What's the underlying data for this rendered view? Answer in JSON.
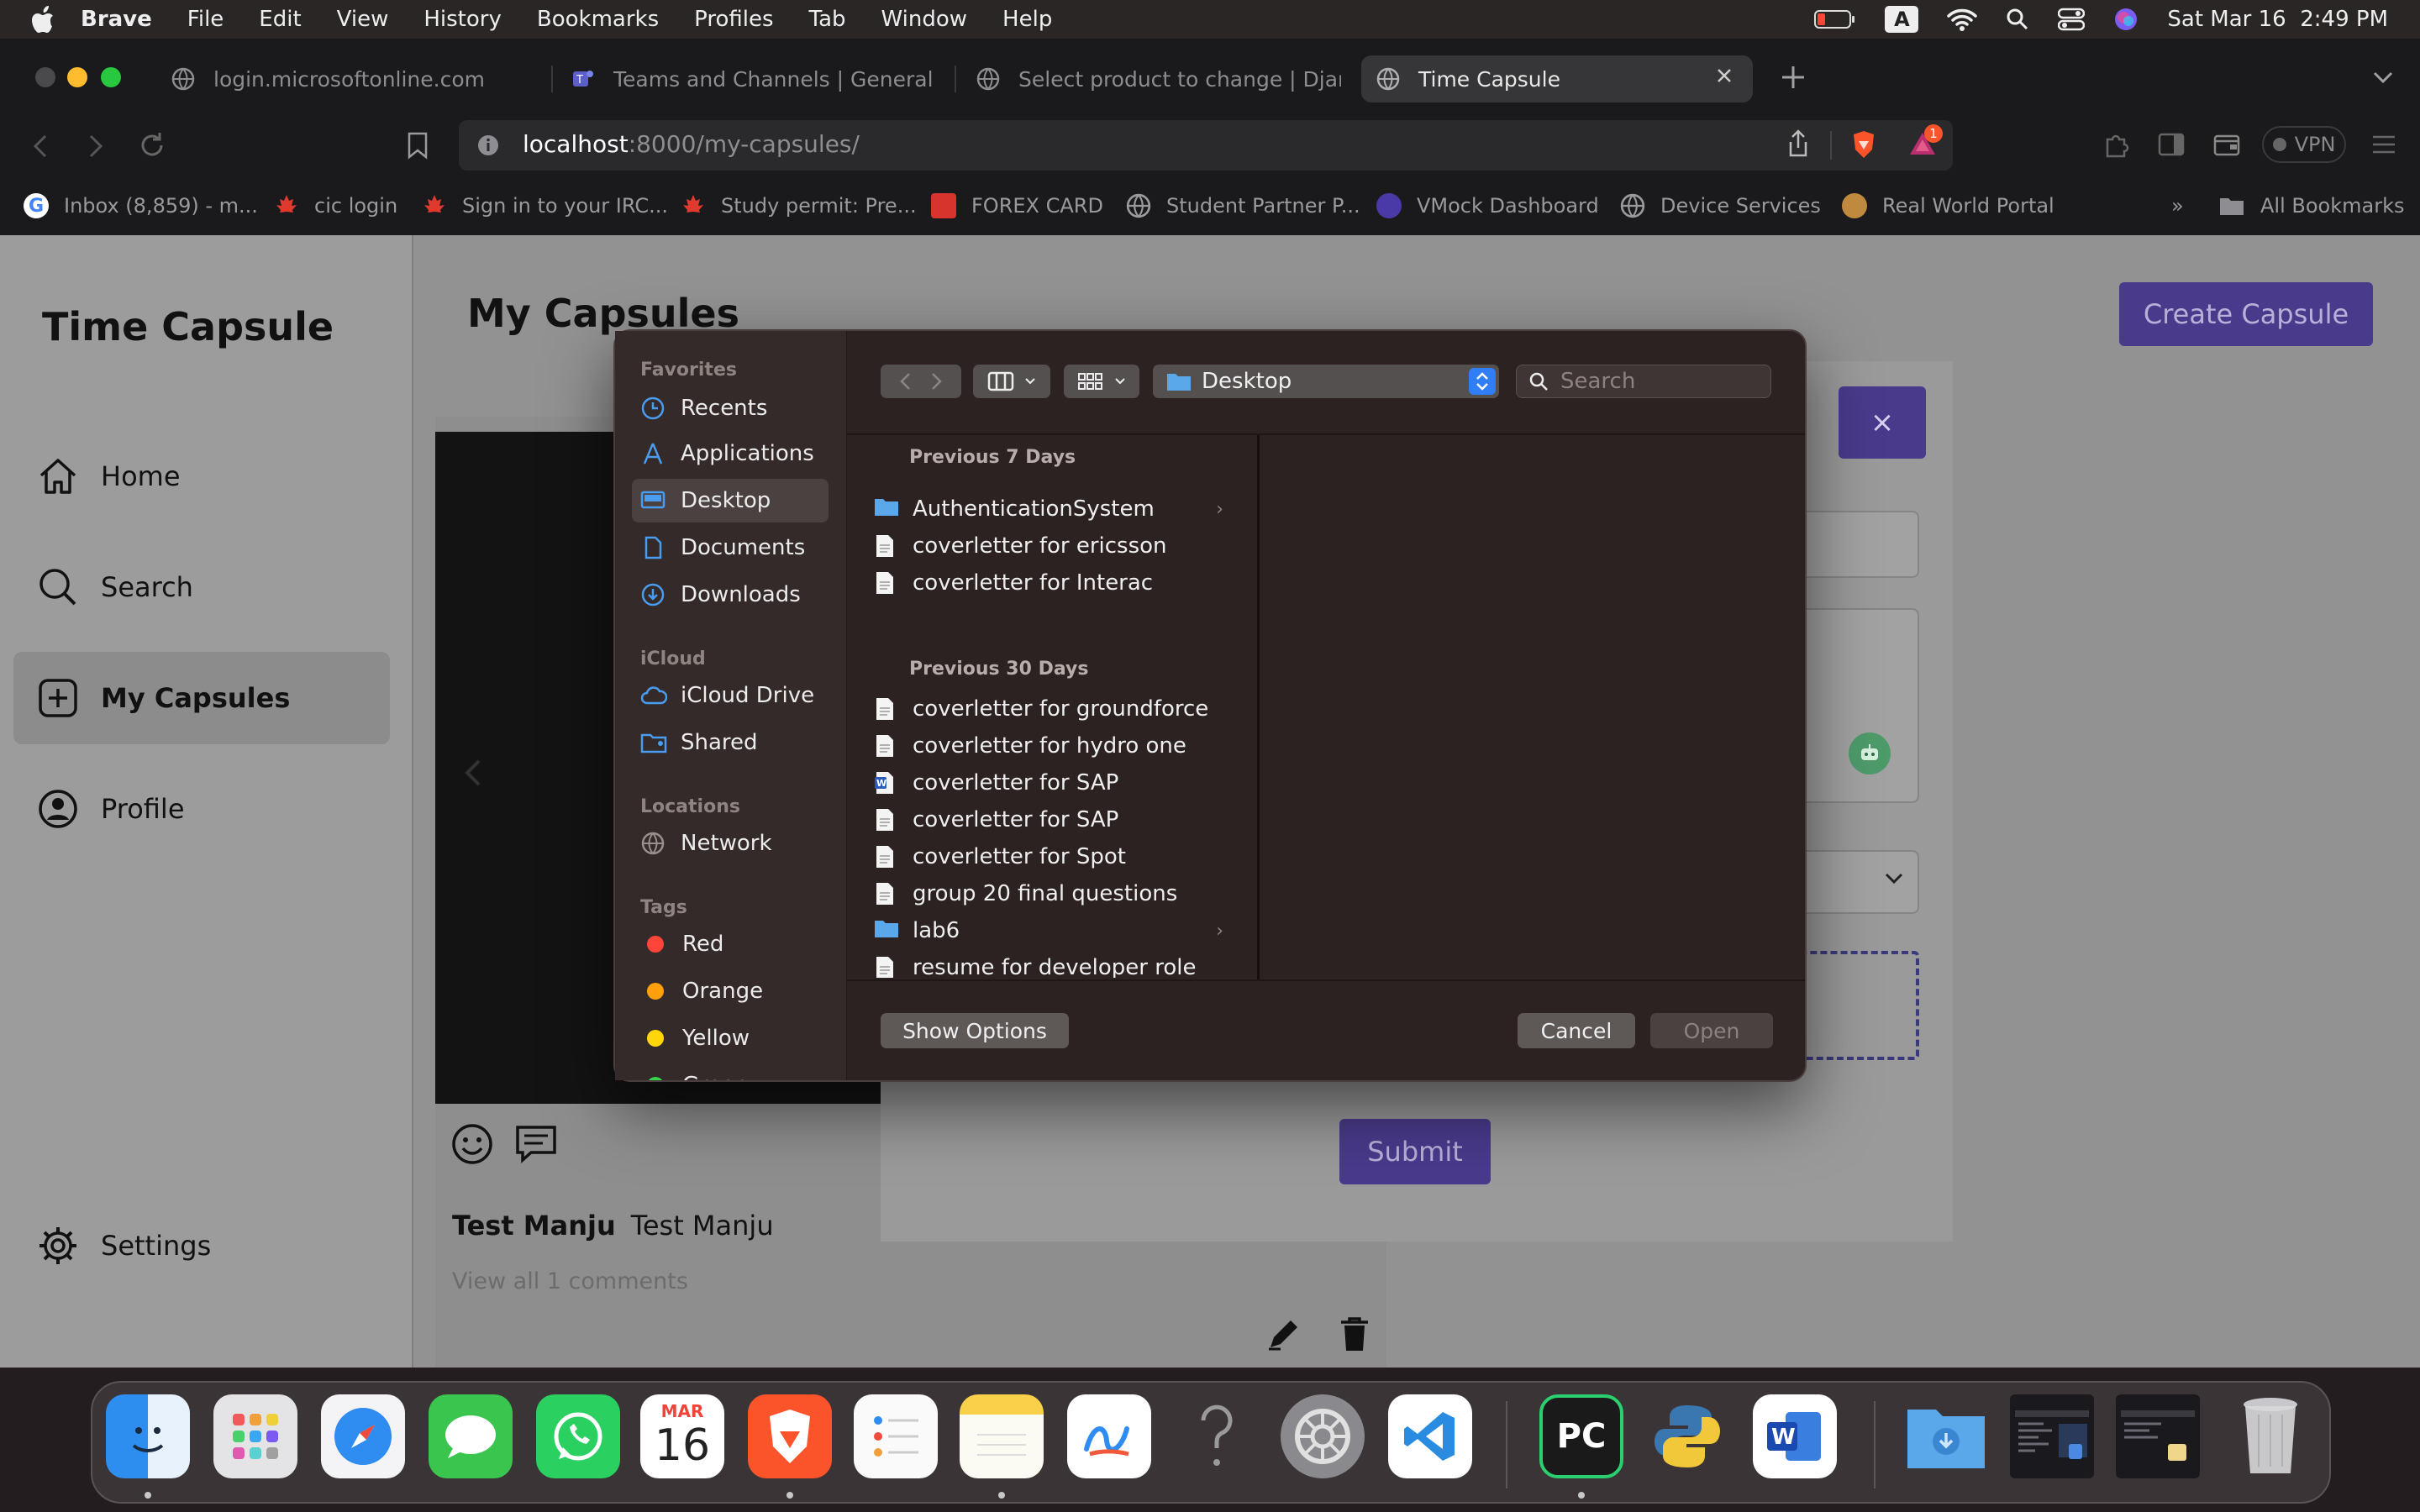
{
  "menubar": {
    "app": "Brave",
    "items": [
      "File",
      "Edit",
      "View",
      "History",
      "Bookmarks",
      "Profiles",
      "Tab",
      "Window",
      "Help"
    ],
    "input_indicator": "A",
    "datetime": "Sat Mar 16  2:49 PM"
  },
  "tabs": [
    {
      "title": "login.microsoftonline.com",
      "active": false
    },
    {
      "title": "Teams and Channels | General | M",
      "active": false
    },
    {
      "title": "Select product to change | Django",
      "active": false
    },
    {
      "title": "Time Capsule",
      "active": true
    }
  ],
  "address_bar": {
    "host": "localhost",
    "path": ":8000/my-capsules/"
  },
  "toolbar": {
    "vpn_label": "VPN",
    "shield_badge": "1"
  },
  "bookmarks": {
    "items": [
      "Inbox (8,859) - m...",
      "cic login",
      "Sign in to your IRC...",
      "Study permit: Pre...",
      "FOREX CARD",
      "Student Partner P...",
      "VMock Dashboard",
      "Device Services",
      "Real World Portal"
    ],
    "overflow": "»",
    "all_label": "All Bookmarks"
  },
  "sidebar": {
    "brand": "Time Capsule",
    "nav": [
      {
        "label": "Home",
        "icon": "home-icon",
        "active": false
      },
      {
        "label": "Search",
        "icon": "search-icon",
        "active": false
      },
      {
        "label": "My Capsules",
        "icon": "plus-square-icon",
        "active": true
      },
      {
        "label": "Profile",
        "icon": "user-icon",
        "active": false
      }
    ],
    "settings_label": "Settings"
  },
  "main": {
    "title": "My Capsules",
    "create_button": "Create Capsule",
    "card": {
      "name_bold": "Test Manju",
      "caption": "Test Manju",
      "view_all": "View all 1 comments"
    },
    "modal": {
      "close_label": "×",
      "submit_label": "Submit"
    }
  },
  "file_dialog": {
    "sidebar": {
      "favorites_header": "Favorites",
      "favorites": [
        "Recents",
        "Applications",
        "Desktop",
        "Documents",
        "Downloads"
      ],
      "selected": "Desktop",
      "icloud_header": "iCloud",
      "icloud": [
        "iCloud Drive",
        "Shared"
      ],
      "locations_header": "Locations",
      "locations": [
        "Network"
      ],
      "tags_header": "Tags",
      "tags": [
        {
          "name": "Red",
          "color": "#ff453a"
        },
        {
          "name": "Orange",
          "color": "#ff9f0a"
        },
        {
          "name": "Yellow",
          "color": "#ffd60a"
        },
        {
          "name": "Green",
          "color": "#32d74b"
        }
      ]
    },
    "location": "Desktop",
    "search_placeholder": "Search",
    "groups": [
      {
        "label": "Previous 7 Days",
        "files": [
          {
            "name": "AuthenticationSystem",
            "kind": "folder"
          },
          {
            "name": "coverletter for ericsson",
            "kind": "doc"
          },
          {
            "name": "coverletter for Interac",
            "kind": "doc"
          }
        ]
      },
      {
        "label": "Previous 30 Days",
        "files": [
          {
            "name": "coverletter for groundforce",
            "kind": "doc"
          },
          {
            "name": "coverletter for hydro one",
            "kind": "doc"
          },
          {
            "name": "coverletter for SAP",
            "kind": "word"
          },
          {
            "name": "coverletter for SAP",
            "kind": "doc"
          },
          {
            "name": "coverletter for Spot",
            "kind": "doc"
          },
          {
            "name": "group 20 final questions",
            "kind": "doc"
          },
          {
            "name": "lab6",
            "kind": "folder"
          },
          {
            "name": "resume for developer role",
            "kind": "doc"
          }
        ]
      }
    ],
    "buttons": {
      "options": "Show Options",
      "cancel": "Cancel",
      "open": "Open"
    }
  },
  "dock": {
    "calendar_month": "MAR",
    "calendar_day": "16"
  },
  "colors": {
    "accent": "#4a3a8c",
    "finder_selection": "#4a4140",
    "folder": "#5aa7ea"
  }
}
